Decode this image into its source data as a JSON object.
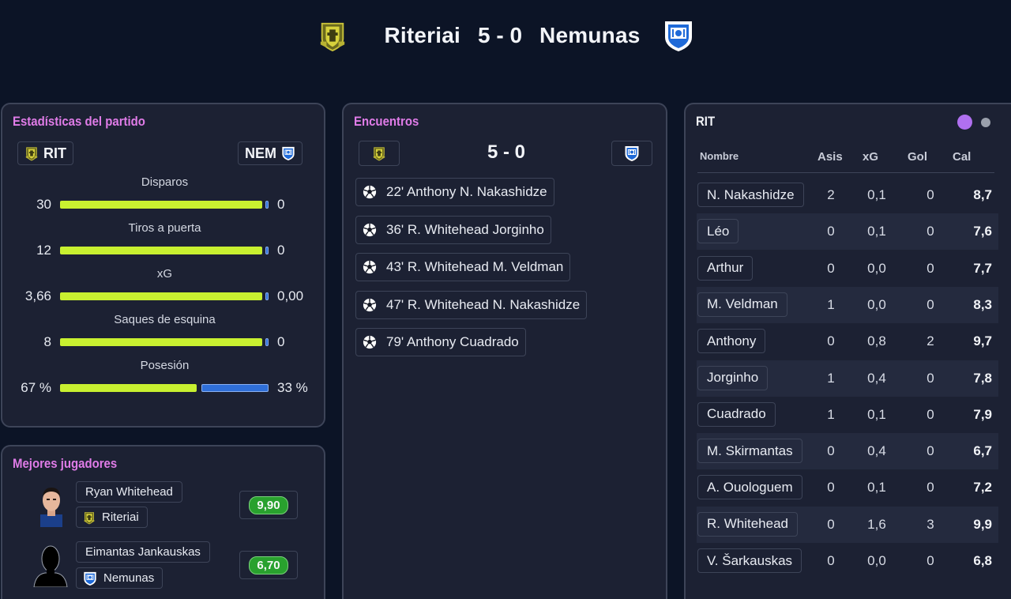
{
  "header": {
    "home_team": "Riteriai",
    "score": "5 - 0",
    "away_team": "Nemunas"
  },
  "stats": {
    "title": "Estadísticas del partido",
    "home_abbr": "RIT",
    "away_abbr": "NEM",
    "rows": [
      {
        "label": "Disparos",
        "home": "30",
        "away": "0",
        "home_share": 0.97
      },
      {
        "label": "Tiros a puerta",
        "home": "12",
        "away": "0",
        "home_share": 0.97
      },
      {
        "label": "xG",
        "home": "3,66",
        "away": "0,00",
        "home_share": 0.97
      },
      {
        "label": "Saques de esquina",
        "home": "8",
        "away": "0",
        "home_share": 0.97
      },
      {
        "label": "Posesión",
        "home": "67 %",
        "away": "33 %",
        "home_share": 0.67
      }
    ]
  },
  "best_players": {
    "title": "Mejores jugadores",
    "players": [
      {
        "name": "Ryan Whitehead",
        "team": "Riteriai",
        "rating": "9,90"
      },
      {
        "name": "Eimantas Jankauskas",
        "team": "Nemunas",
        "rating": "6,70"
      }
    ]
  },
  "encounters": {
    "title": "Encuentros",
    "score": "5 - 0",
    "events": [
      {
        "minute": "22'",
        "text": "Anthony N. Nakashidze"
      },
      {
        "minute": "36'",
        "text": "R. Whitehead Jorginho"
      },
      {
        "minute": "43'",
        "text": "R. Whitehead M. Veldman"
      },
      {
        "minute": "47'",
        "text": "R. Whitehead N. Nakashidze"
      },
      {
        "minute": "79'",
        "text": "Anthony Cuadrado"
      }
    ]
  },
  "ratings": {
    "title": "RIT",
    "columns": {
      "name": "Nombre",
      "asis": "Asis",
      "xg": "xG",
      "gol": "Gol",
      "cal": "Cal"
    },
    "players": [
      {
        "name": "N. Nakashidze",
        "asis": "2",
        "xg": "0,1",
        "gol": "0",
        "cal": "8,7"
      },
      {
        "name": "Léo",
        "asis": "0",
        "xg": "0,1",
        "gol": "0",
        "cal": "7,6"
      },
      {
        "name": "Arthur",
        "asis": "0",
        "xg": "0,0",
        "gol": "0",
        "cal": "7,7"
      },
      {
        "name": "M. Veldman",
        "asis": "1",
        "xg": "0,0",
        "gol": "0",
        "cal": "8,3"
      },
      {
        "name": "Anthony",
        "asis": "0",
        "xg": "0,8",
        "gol": "2",
        "cal": "9,7"
      },
      {
        "name": "Jorginho",
        "asis": "1",
        "xg": "0,4",
        "gol": "0",
        "cal": "7,8"
      },
      {
        "name": "Cuadrado",
        "asis": "1",
        "xg": "0,1",
        "gol": "0",
        "cal": "7,9"
      },
      {
        "name": "M. Skirmantas",
        "asis": "0",
        "xg": "0,4",
        "gol": "0",
        "cal": "6,7"
      },
      {
        "name": "A. Ouologuem",
        "asis": "0",
        "xg": "0,1",
        "gol": "0",
        "cal": "7,2"
      },
      {
        "name": "R. Whitehead",
        "asis": "0",
        "xg": "1,6",
        "gol": "3",
        "cal": "9,9"
      },
      {
        "name": "V. Šarkauskas",
        "asis": "0",
        "xg": "0,0",
        "gol": "0",
        "cal": "6,8"
      }
    ]
  },
  "colors": {
    "home_bar": "#c8f030",
    "away_bar": "#2f6fd8",
    "accent_title": "#e07ce8",
    "rating_pill": "#29a12e",
    "dot_active": "#b070f0",
    "dot_inactive": "#9aa0ac"
  },
  "icons": {
    "home_crest": "riteriai-crest-icon",
    "away_crest": "nemunas-crest-icon",
    "goal": "football-icon"
  }
}
